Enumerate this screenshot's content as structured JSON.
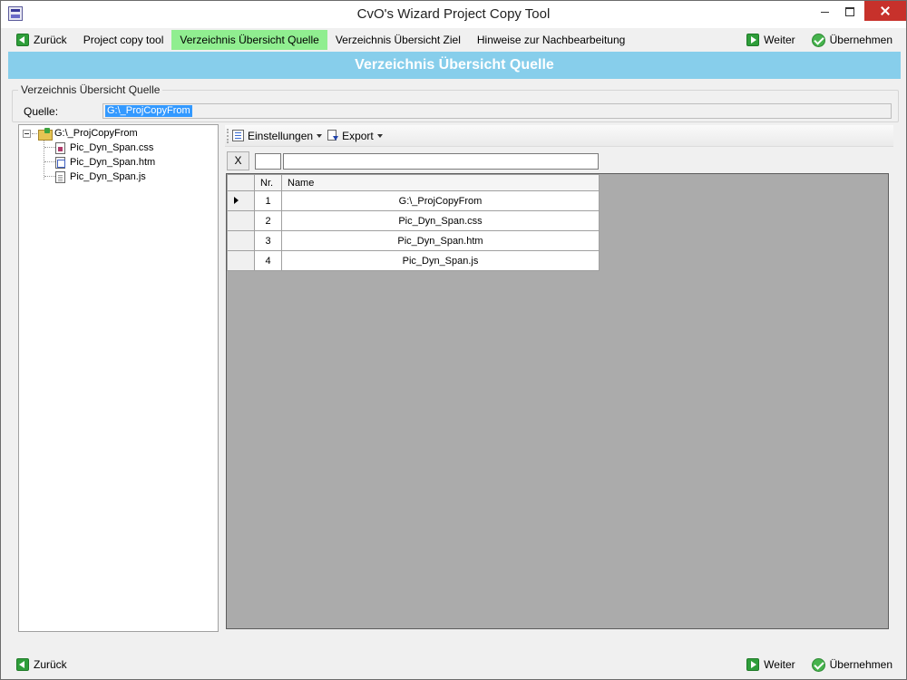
{
  "window": {
    "title": "CvO's Wizard Project Copy Tool"
  },
  "nav": {
    "back_label": "Zurück",
    "steps": [
      {
        "label": "Project copy tool",
        "active": false
      },
      {
        "label": "Verzeichnis Übersicht Quelle",
        "active": true
      },
      {
        "label": "Verzeichnis Übersicht Ziel",
        "active": false
      },
      {
        "label": "Hinweise zur Nachbearbeitung",
        "active": false
      }
    ],
    "next_label": "Weiter",
    "apply_label": "Übernehmen"
  },
  "header": {
    "title": "Verzeichnis Übersicht Quelle"
  },
  "group": {
    "legend": "Verzeichnis Übersicht Quelle",
    "source_label": "Quelle:",
    "source_value": "G:\\_ProjCopyFrom"
  },
  "tree": {
    "root": "G:\\_ProjCopyFrom",
    "children": [
      "Pic_Dyn_Span.css",
      "Pic_Dyn_Span.htm",
      "Pic_Dyn_Span.js"
    ]
  },
  "toolbar": {
    "settings_label": "Einstellungen",
    "export_label": "Export"
  },
  "filter": {
    "clear_label": "X",
    "nr_value": "",
    "name_value": ""
  },
  "grid": {
    "columns": [
      "Nr.",
      "Name"
    ],
    "rows": [
      {
        "nr": "1",
        "name": "G:\\_ProjCopyFrom"
      },
      {
        "nr": "2",
        "name": "Pic_Dyn_Span.css"
      },
      {
        "nr": "3",
        "name": "Pic_Dyn_Span.htm"
      },
      {
        "nr": "4",
        "name": "Pic_Dyn_Span.js"
      }
    ]
  },
  "colors": {
    "active_step": "#90ee90",
    "header_band": "#87ceeb",
    "selection": "#3399ff",
    "close_button": "#c7312b"
  }
}
